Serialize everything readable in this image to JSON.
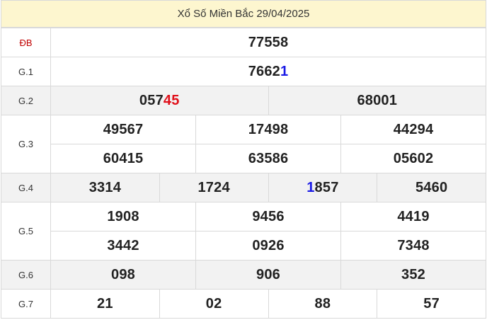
{
  "title": "Xổ Số Miền Bắc 29/04/2025",
  "prizes": {
    "db": {
      "label": "ĐB",
      "values": [
        "77558"
      ]
    },
    "g1": {
      "label": "G.1",
      "values": [
        {
          "main": "7662",
          "accent": "1"
        }
      ]
    },
    "g2": {
      "label": "G.2",
      "values": [
        {
          "main": "057",
          "accent": "45"
        },
        "68001"
      ]
    },
    "g3": {
      "label": "G.3",
      "values": [
        "49567",
        "17498",
        "44294",
        "60415",
        "63586",
        "05602"
      ]
    },
    "g4": {
      "label": "G.4",
      "values": [
        "3314",
        "1724",
        {
          "accent": "1",
          "main": "857"
        },
        "5460"
      ]
    },
    "g5": {
      "label": "G.5",
      "values": [
        "1908",
        "9456",
        "4419",
        "3442",
        "0926",
        "7348"
      ]
    },
    "g6": {
      "label": "G.6",
      "values": [
        "098",
        "906",
        "352"
      ]
    },
    "g7": {
      "label": "G.7",
      "values": [
        "21",
        "02",
        "88",
        "57"
      ]
    }
  },
  "colors": {
    "header_bg": "#fdf6cf",
    "accent_red": "#e0101a",
    "accent_blue": "#1a1ae6",
    "row_shade": "#f2f2f2"
  }
}
